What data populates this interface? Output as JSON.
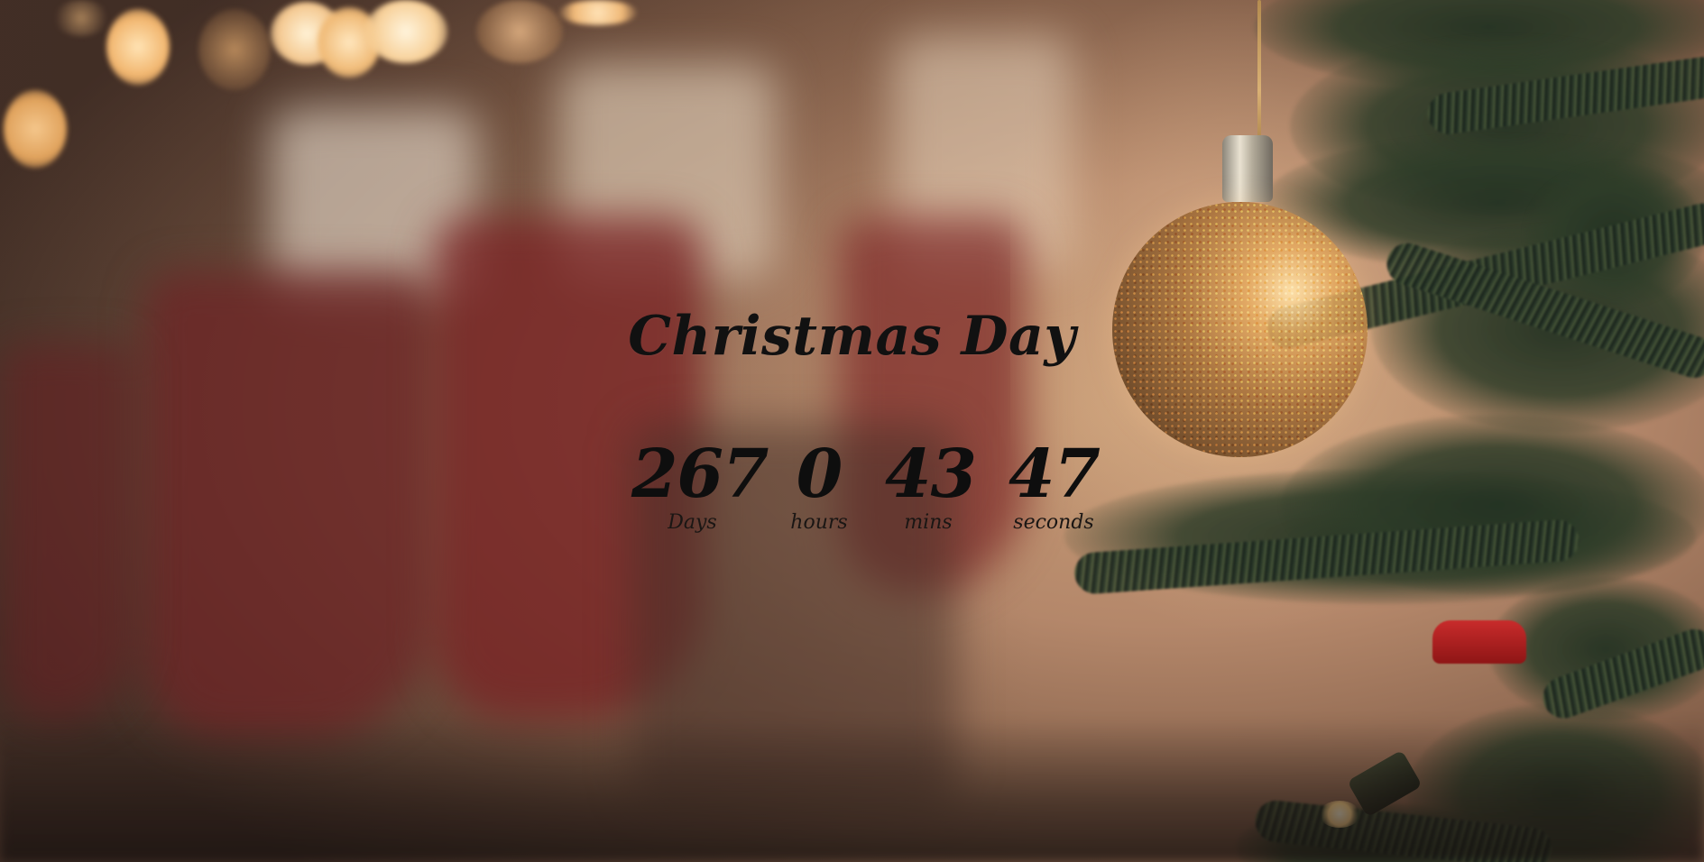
{
  "page": {
    "title": "Christmas Day"
  },
  "countdown": {
    "days": {
      "value": "267",
      "label": "Days"
    },
    "hours": {
      "value": "0",
      "label": "hours"
    },
    "mins": {
      "value": "43",
      "label": "mins"
    },
    "seconds": {
      "value": "47",
      "label": "seconds"
    }
  },
  "background": {
    "description_icon": "christmas-tree-ornament-photo",
    "accent_colors": [
      "#c89d76",
      "#8e1515",
      "#d9b074"
    ]
  }
}
